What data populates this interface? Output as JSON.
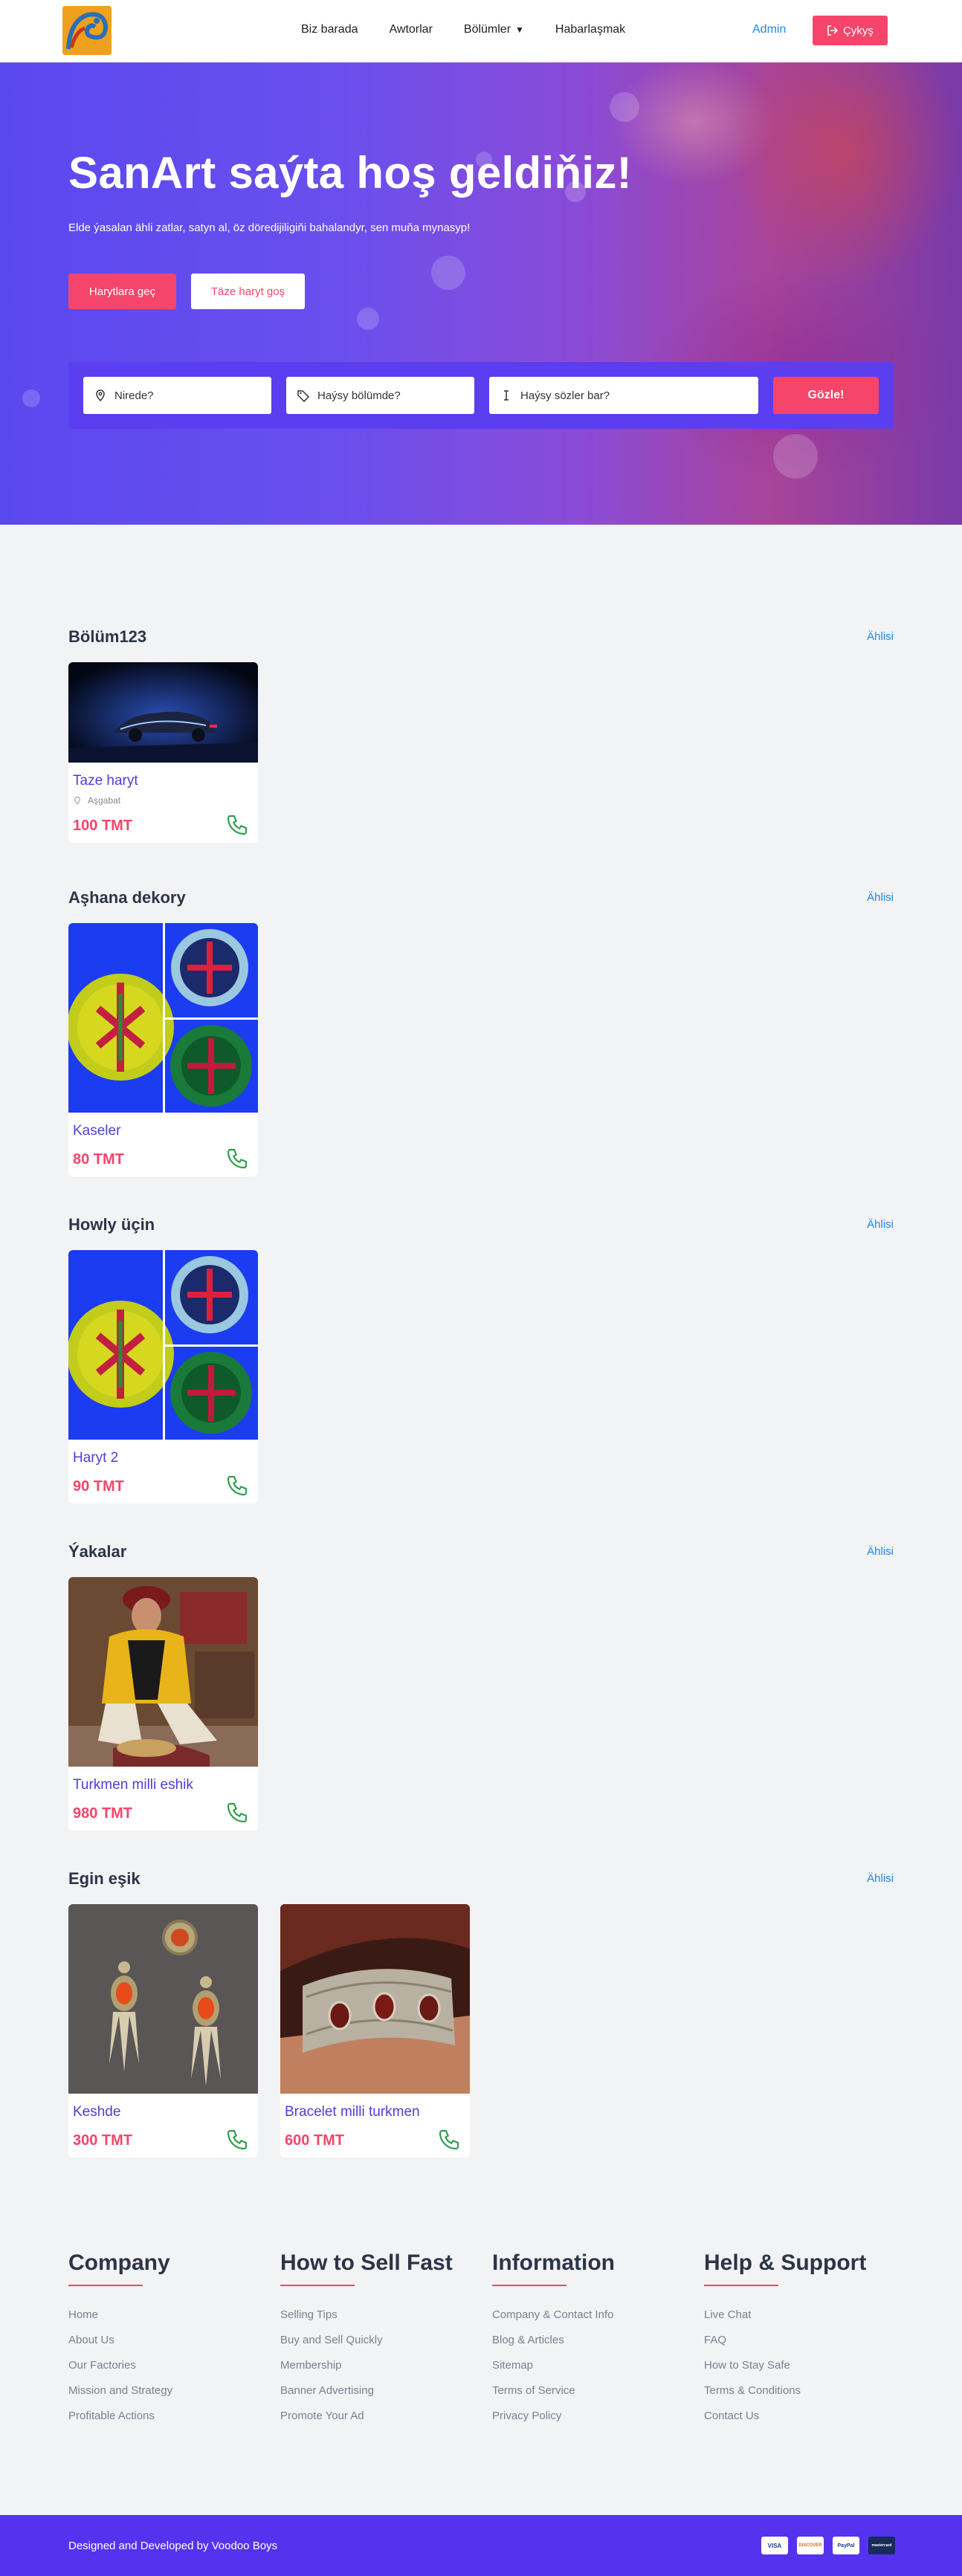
{
  "nav": {
    "items": [
      "Biz barada",
      "Awtorlar",
      "Bölümler",
      "Habarlaşmak"
    ],
    "admin": "Admin",
    "logout": "Çykyş"
  },
  "hero": {
    "title": "SanArt saýta hoş geldiňiz!",
    "subtitle": "Elde ýasalan ähli zatlar, satyn al, öz döredijiligiňi bahalandyr, sen muňa mynasyp!",
    "btn_products": "Harytlara geç",
    "btn_add": "Täze haryt goş",
    "search": {
      "where": "Nirede?",
      "category": "Haýsy bölümde?",
      "keywords": "Haýsy sözler bar?",
      "submit": "Gözle!"
    }
  },
  "see_all": "Ählisi",
  "sections": [
    {
      "title": "Bölüm123",
      "products": [
        {
          "title": "Taze haryt",
          "location": "Aşgabat",
          "price": "100 TMT"
        }
      ]
    },
    {
      "title": "Aşhana dekory",
      "products": [
        {
          "title": "Kaseler",
          "price": "80 TMT"
        }
      ]
    },
    {
      "title": "Howly üçin",
      "products": [
        {
          "title": "Haryt 2",
          "price": "90 TMT"
        }
      ]
    },
    {
      "title": "Ýakalar",
      "products": [
        {
          "title": "Turkmen milli eshik",
          "price": "980 TMT"
        }
      ]
    },
    {
      "title": "Egin eşik",
      "products": [
        {
          "title": "Keshde",
          "price": "300 TMT"
        },
        {
          "title": "Bracelet milli turkmen",
          "price": "600 TMT"
        }
      ]
    }
  ],
  "footer": {
    "columns": [
      {
        "title": "Company",
        "links": [
          "Home",
          "About Us",
          "Our Factories",
          "Mission and Strategy",
          "Profitable Actions"
        ]
      },
      {
        "title": "How to Sell Fast",
        "links": [
          "Selling Tips",
          "Buy and Sell Quickly",
          "Membership",
          "Banner Advertising",
          "Promote Your Ad"
        ]
      },
      {
        "title": "Information",
        "links": [
          "Company & Contact Info",
          "Blog & Articles",
          "Sitemap",
          "Terms of Service",
          "Privacy Policy"
        ]
      },
      {
        "title": "Help & Support",
        "links": [
          "Live Chat",
          "FAQ",
          "How to Stay Safe",
          "Terms & Conditions",
          "Contact Us"
        ]
      }
    ],
    "credit": "Designed and Developed by Voodoo Boys",
    "payments": [
      "VISA",
      "DISCOVER",
      "PayPal",
      "mastercard"
    ]
  },
  "colors": {
    "accent": "#f5456a",
    "brand": "#5533ee",
    "link": "#1e88e5",
    "title": "#4d3fd6"
  }
}
